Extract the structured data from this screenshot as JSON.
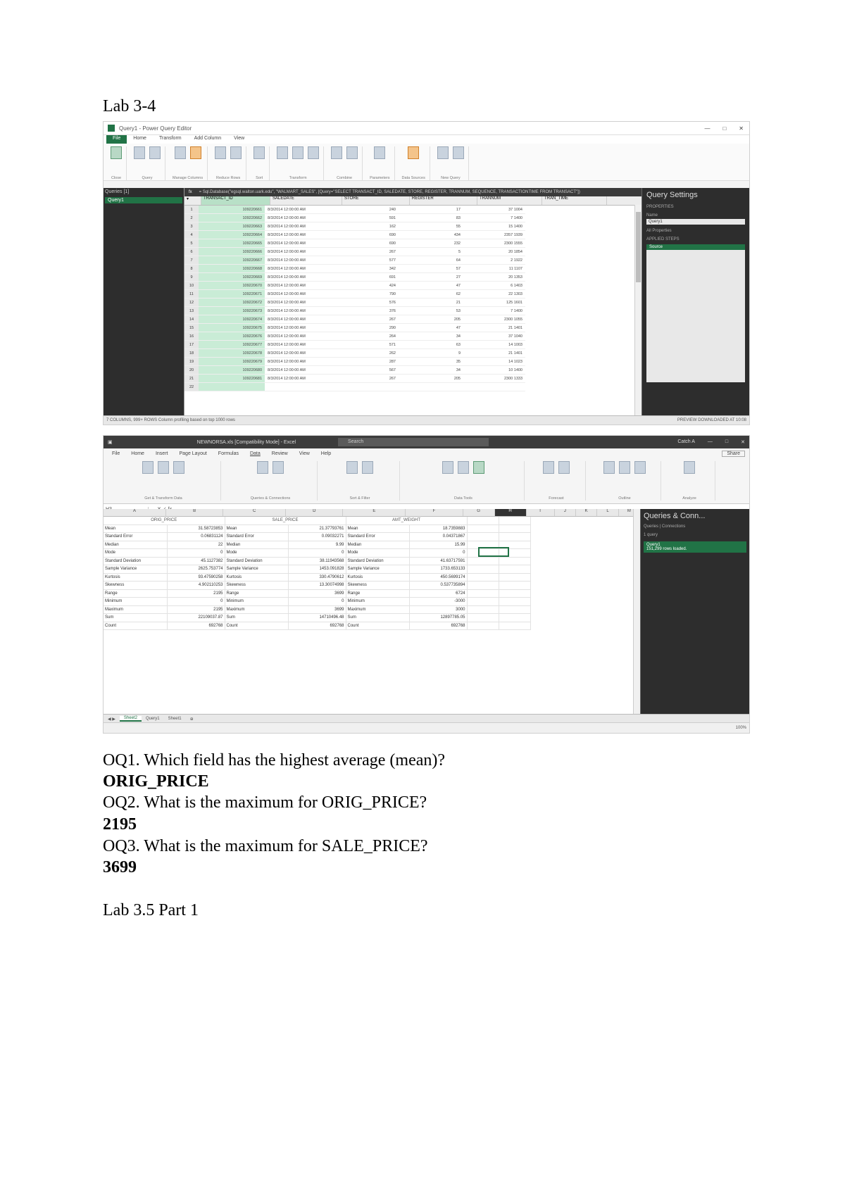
{
  "document": {
    "heading_lab34": "Lab 3-4",
    "q1": "OQ1. Which field has the highest average (mean)?",
    "a1": "ORIG_PRICE",
    "q2": "OQ2. What is the maximum for ORIG_PRICE?",
    "a2": "2195",
    "q3": "OQ3. What is the maximum for SALE_PRICE?",
    "a3": "3699",
    "heading_lab35": "Lab 3.5 Part 1"
  },
  "power_query": {
    "title": "Query1 - Power Query Editor",
    "tabs": [
      "File",
      "Home",
      "Transform",
      "Add Column",
      "View"
    ],
    "active_tab": "File",
    "ribbon_groups": [
      "Close",
      "Query",
      "Manage Columns",
      "Reduce Rows",
      "Sort",
      "Transform",
      "Combine",
      "Parameters",
      "Data Sources",
      "New Query"
    ],
    "nav_header": "Queries [1]",
    "nav_query": "Query1",
    "formula": "= Sql.Database(\"egsql.walton.uark.edu\", \"WALMART_SALES\", [Query=\"SELECT TRANSACT_ID, SALEDATE, STORE, REGISTER, TRANNUM, SEQUENCE, TRANSACTIONTIME FROM TRANSACT\"])",
    "columns": [
      "TRANSACT_ID",
      "SALEDATE",
      "STORE",
      "REGISTER",
      "TRANNUM",
      "SEQ",
      "TRAN_TIME"
    ],
    "rows": [
      [
        "1",
        "109220661",
        "8/3/2014 12:00:00 AM",
        "240",
        "17",
        "37 1004"
      ],
      [
        "2",
        "109220662",
        "8/3/2014 12:00:00 AM",
        "591",
        "83",
        "7 1400"
      ],
      [
        "3",
        "109220663",
        "8/3/2014 12:00:00 AM",
        "162",
        "55",
        "15 1400"
      ],
      [
        "4",
        "109220664",
        "8/3/2014 12:00:00 AM",
        "690",
        "434",
        "2357 1939"
      ],
      [
        "5",
        "109220665",
        "8/3/2014 12:00:00 AM",
        "690",
        "232",
        "2300 1555"
      ],
      [
        "6",
        "109220666",
        "8/3/2014 12:00:00 AM",
        "267",
        "5",
        "20 1854"
      ],
      [
        "7",
        "109220667",
        "8/3/2014 12:00:00 AM",
        "577",
        "64",
        "2 1922"
      ],
      [
        "8",
        "109220668",
        "8/3/2014 12:00:00 AM",
        "342",
        "57",
        "11 1107"
      ],
      [
        "9",
        "109220669",
        "8/3/2014 12:00:00 AM",
        "691",
        "27",
        "20 1353"
      ],
      [
        "10",
        "109220670",
        "8/3/2014 12:00:00 AM",
        "424",
        "47",
        "6 1403"
      ],
      [
        "11",
        "109220671",
        "8/3/2014 12:00:00 AM",
        "790",
        "62",
        "22 1303"
      ],
      [
        "12",
        "109220672",
        "8/3/2014 12:00:00 AM",
        "576",
        "21",
        "125 1601"
      ],
      [
        "13",
        "109220673",
        "8/3/2014 12:00:00 AM",
        "376",
        "53",
        "7 1400"
      ],
      [
        "14",
        "109220674",
        "8/3/2014 12:00:00 AM",
        "267",
        "205",
        "2300 1055"
      ],
      [
        "15",
        "109220675",
        "8/3/2014 12:00:00 AM",
        "290",
        "47",
        "21 1401"
      ],
      [
        "16",
        "109220676",
        "8/3/2014 12:00:00 AM",
        "264",
        "34",
        "37 1040"
      ],
      [
        "17",
        "109220677",
        "8/3/2014 12:00:00 AM",
        "571",
        "63",
        "14 1003"
      ],
      [
        "18",
        "109220678",
        "8/3/2014 12:00:00 AM",
        "262",
        "9",
        "21 1401"
      ],
      [
        "19",
        "109220679",
        "8/3/2014 12:00:00 AM",
        "287",
        "35",
        "14 1023"
      ],
      [
        "20",
        "109220680",
        "8/3/2014 12:00:00 AM",
        "567",
        "34",
        "10 1400"
      ],
      [
        "21",
        "109220681",
        "8/3/2014 12:00:00 AM",
        "267",
        "205",
        "2300 1333"
      ],
      [
        "22",
        "",
        "",
        "",
        "",
        ""
      ]
    ],
    "settings_title": "Query Settings",
    "properties_label": "PROPERTIES",
    "name_label": "Name",
    "name_value": "Query1",
    "all_properties": "All Properties",
    "applied_steps_label": "APPLIED STEPS",
    "step": "Source",
    "status_left": "7 COLUMNS, 999+ ROWS    Column profiling based on top 1000 rows",
    "status_right": "PREVIEW DOWNLOADED AT 10:08"
  },
  "excel": {
    "title": "NEWNORSA.xls [Compatibility Mode] - Excel",
    "search": "Search",
    "user": "Catch A",
    "tabs": [
      "File",
      "Home",
      "Insert",
      "Page Layout",
      "Formulas",
      "Data",
      "Review",
      "View",
      "Help"
    ],
    "active_tab": "Data",
    "share": "Share",
    "ribbon_groups": [
      "Get & Transform Data",
      "Queries & Connections",
      "Sort & Filter",
      "Data Tools",
      "Forecast",
      "Outline",
      "Analyze"
    ],
    "namebox": "H3",
    "col_letters": [
      "A",
      "B",
      "C",
      "D",
      "E",
      "F",
      "G",
      "H",
      "I",
      "J",
      "K",
      "L",
      "M"
    ],
    "stats_headers": [
      "ORIG_PRICE",
      "SALE_PRICE",
      "AMT_WEIGHT"
    ],
    "stats_rows": [
      [
        "Mean",
        "31.58723853",
        "Mean",
        "21.37793761",
        "Mean",
        "18.7359883"
      ],
      [
        "Standard Error",
        "0.06831124",
        "Standard Error",
        "0.09032271",
        "Standard Error",
        "0.04371867"
      ],
      [
        "Median",
        "22",
        "Median",
        "9.99",
        "Median",
        "15.99"
      ],
      [
        "Mode",
        "0",
        "Mode",
        "0",
        "Mode",
        "0"
      ],
      [
        "Standard Deviation",
        "45.1127382",
        "Standard Deviation",
        "38.11943568",
        "Standard Deviation",
        "41.63717591"
      ],
      [
        "Sample Variance",
        "2625.753774",
        "Sample Variance",
        "1453.091828",
        "Sample Variance",
        "1733.653133"
      ],
      [
        "Kurtosis",
        "93.47590258",
        "Kurtosis",
        "330.4790612",
        "Kurtosis",
        "450.5699174"
      ],
      [
        "Skewness",
        "4.902110253",
        "Skewness",
        "13.30074998",
        "Skewness",
        "0.537735894"
      ],
      [
        "Range",
        "2195",
        "Range",
        "3699",
        "Range",
        "6724"
      ],
      [
        "Minimum",
        "0",
        "Minimum",
        "0",
        "Minimum",
        "-3000"
      ],
      [
        "Maximum",
        "2195",
        "Maximum",
        "3699",
        "Maximum",
        "3000"
      ],
      [
        "Sum",
        "22109037.87",
        "Sum",
        "14710496.48",
        "Sum",
        "12897785.05"
      ],
      [
        "Count",
        "692768",
        "Count",
        "692768",
        "Count",
        "692768"
      ]
    ],
    "pane_title": "Queries & Conn...",
    "pane_tabs": "Queries | Connections",
    "pane_count": "1 query",
    "pane_query": "Query1",
    "pane_query_rows": "151,299 rows loaded.",
    "sheet_tabs": [
      "Sheet2",
      "Query1",
      "Sheet1"
    ],
    "active_sheet": "Sheet2",
    "status_right": "100%"
  }
}
